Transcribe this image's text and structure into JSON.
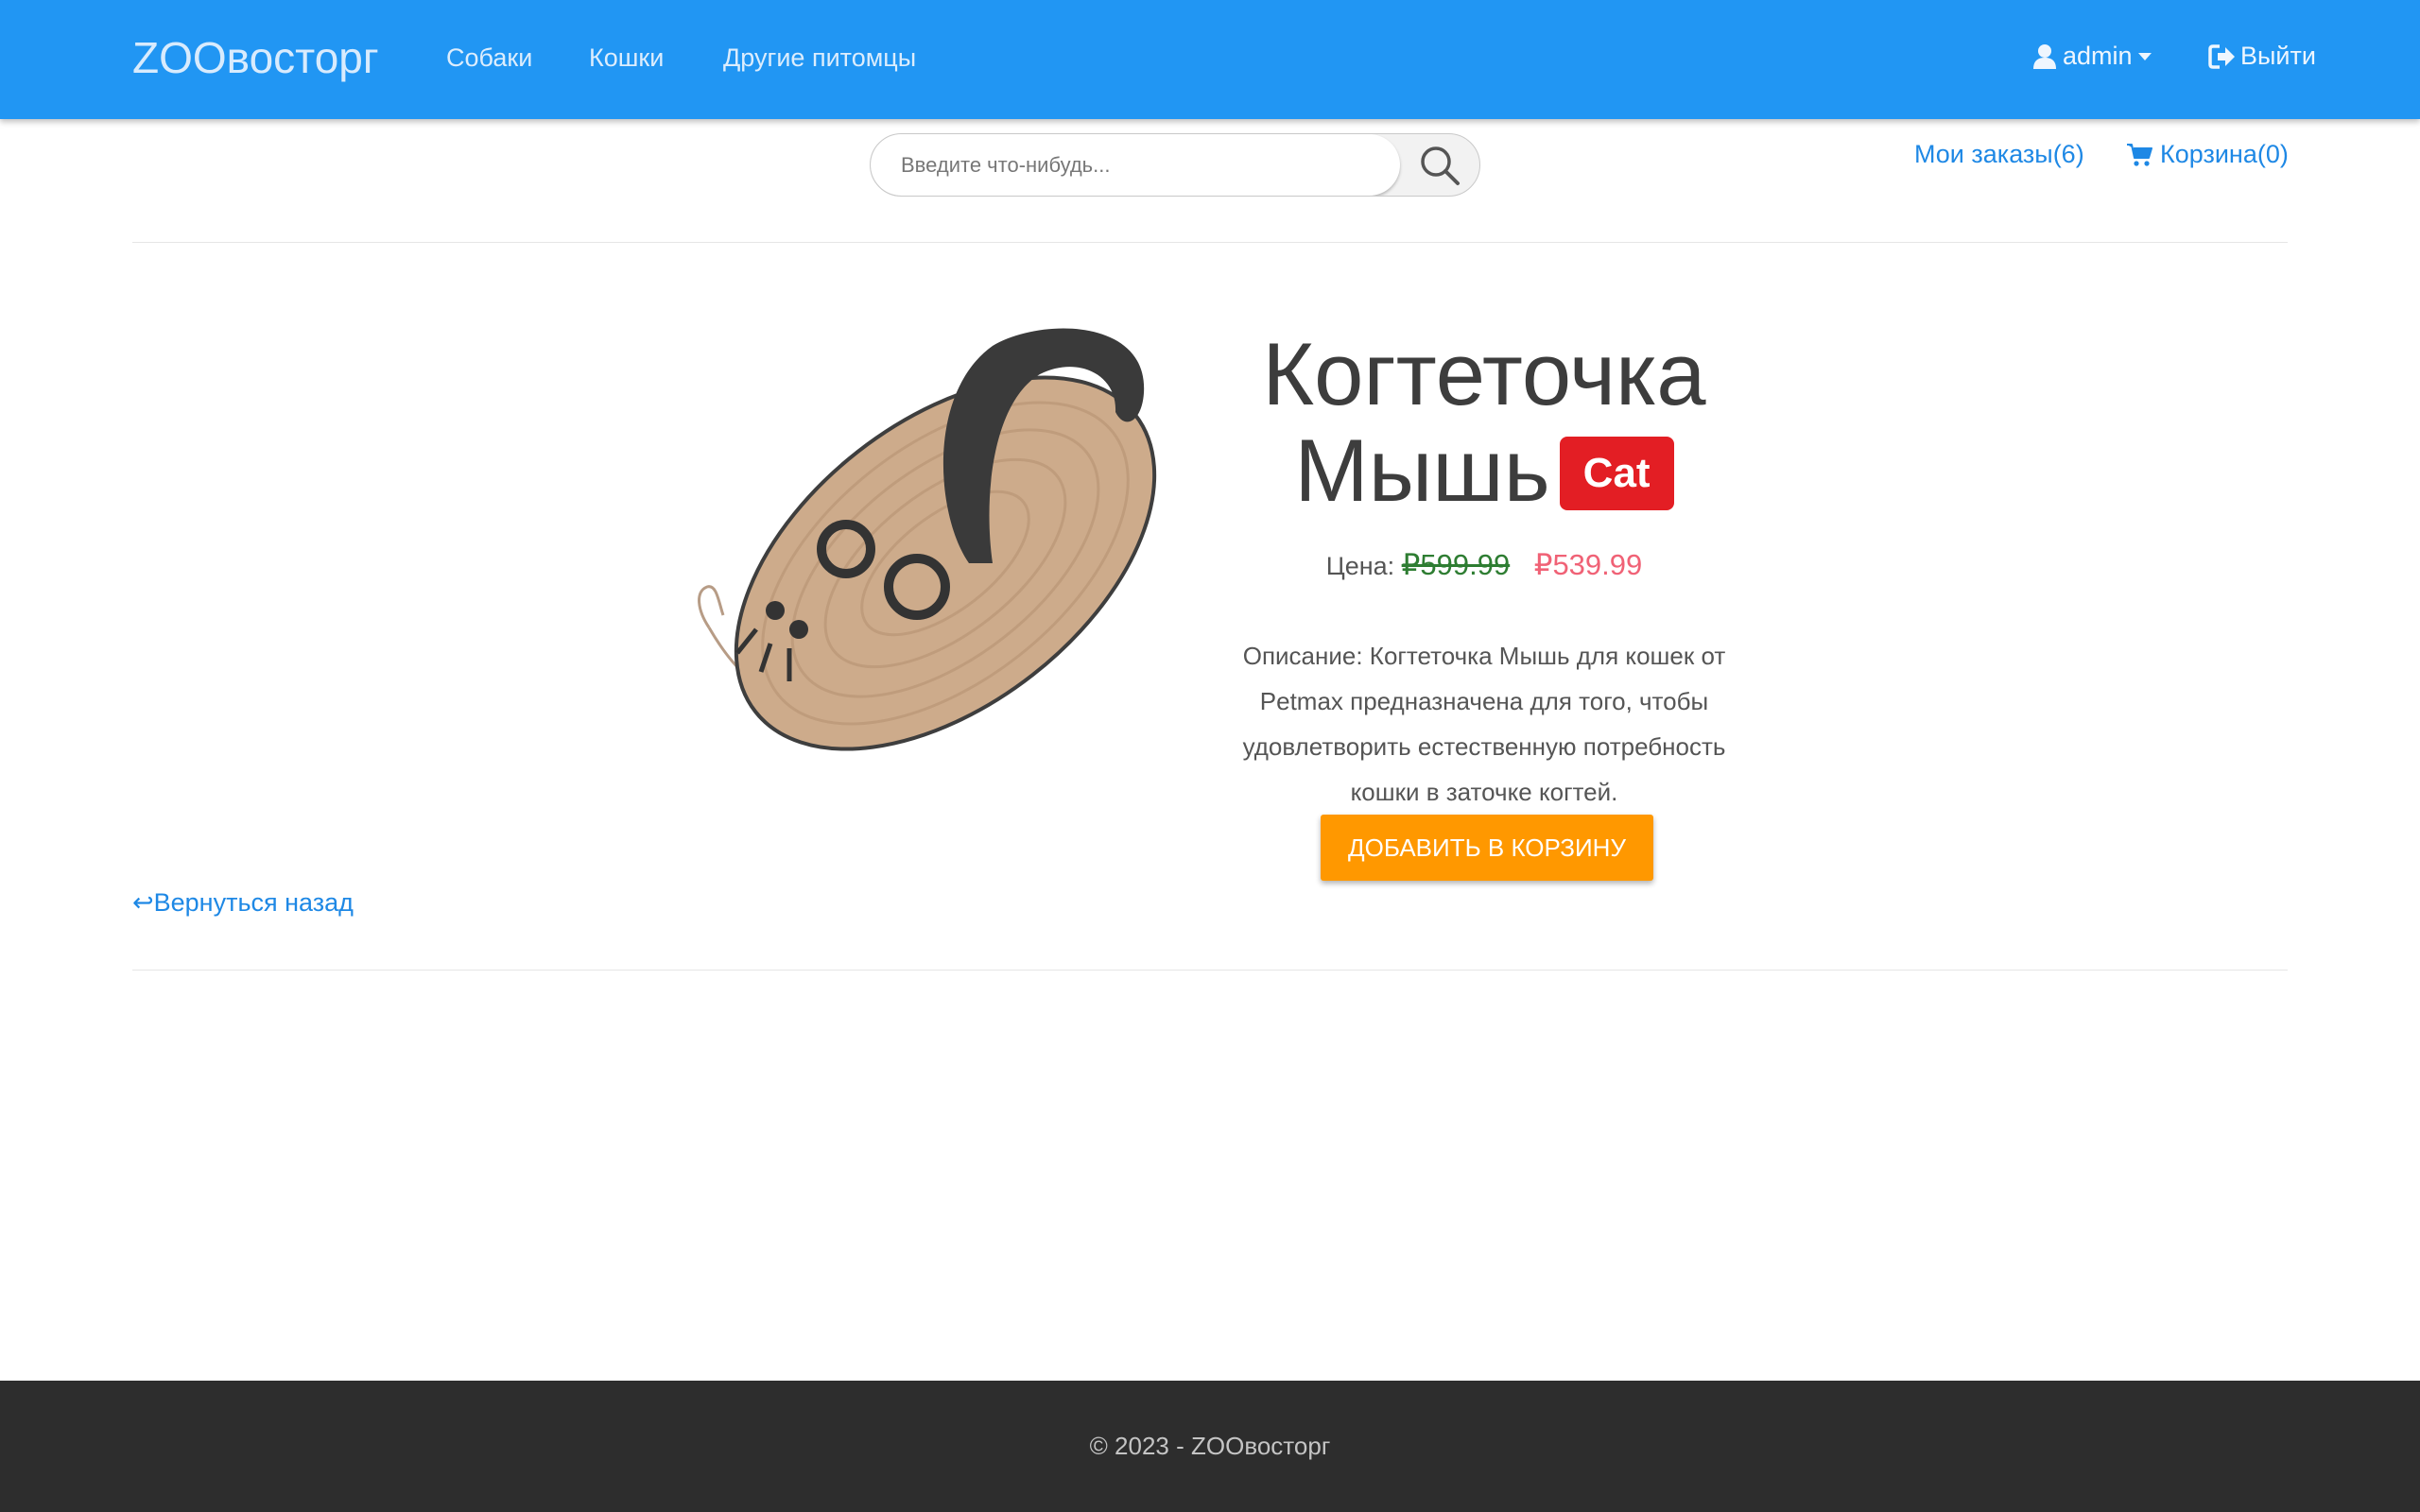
{
  "navbar": {
    "brand": "ZOOвосторг",
    "links": [
      "Собаки",
      "Кошки",
      "Другие питомцы"
    ],
    "user": "admin",
    "logout": "Выйти"
  },
  "search": {
    "placeholder": "Введите что-нибудь..."
  },
  "top_links": {
    "orders": "Мои заказы(6)",
    "cart": "Корзина(0)"
  },
  "product": {
    "title_line1": "Когтеточка",
    "title_line2": "Мышь",
    "badge": "Cat",
    "price_label": "Цена:",
    "old_price": "₽599.99",
    "new_price": "₽539.99",
    "description": "Описание: Когтеточка Мышь для кошек от Petmax предназначена для того, чтобы удовлетворить естественную потребность кошки в заточке когтей.",
    "add_to_cart": "ДОБАВИТЬ В КОРЗИНУ"
  },
  "back_link": "↩Вернуться назад",
  "footer": {
    "text": "© 2023 - ZOOвосторг"
  },
  "colors": {
    "navbar": "#2196f3",
    "link": "#1e88e5",
    "badge": "#e31e24",
    "old_price": "#2e7d32",
    "new_price": "#f06276",
    "cart_button": "#ff9800",
    "footer": "#2d2d2d"
  }
}
